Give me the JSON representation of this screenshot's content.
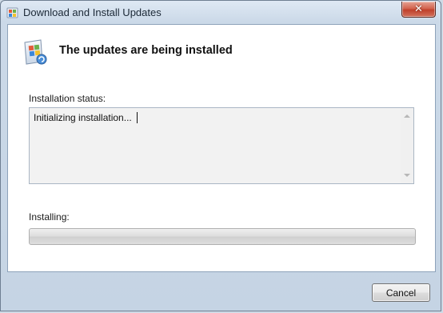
{
  "window": {
    "title": "Download and Install Updates",
    "close_symbol": "✕",
    "app_icon": "windows-update-icon"
  },
  "main": {
    "heading": "The updates are being installed",
    "heading_icon": "windows-update-icon",
    "status_label": "Installation status:",
    "status_text": "Initializing installation...",
    "installing_label": "Installing:",
    "progress_fraction": 0
  },
  "footer": {
    "cancel_label": "Cancel"
  },
  "colors": {
    "close_button": "#c7432d",
    "progress_track": "#dcdcdc",
    "window_frame": "#cbd9e8"
  }
}
